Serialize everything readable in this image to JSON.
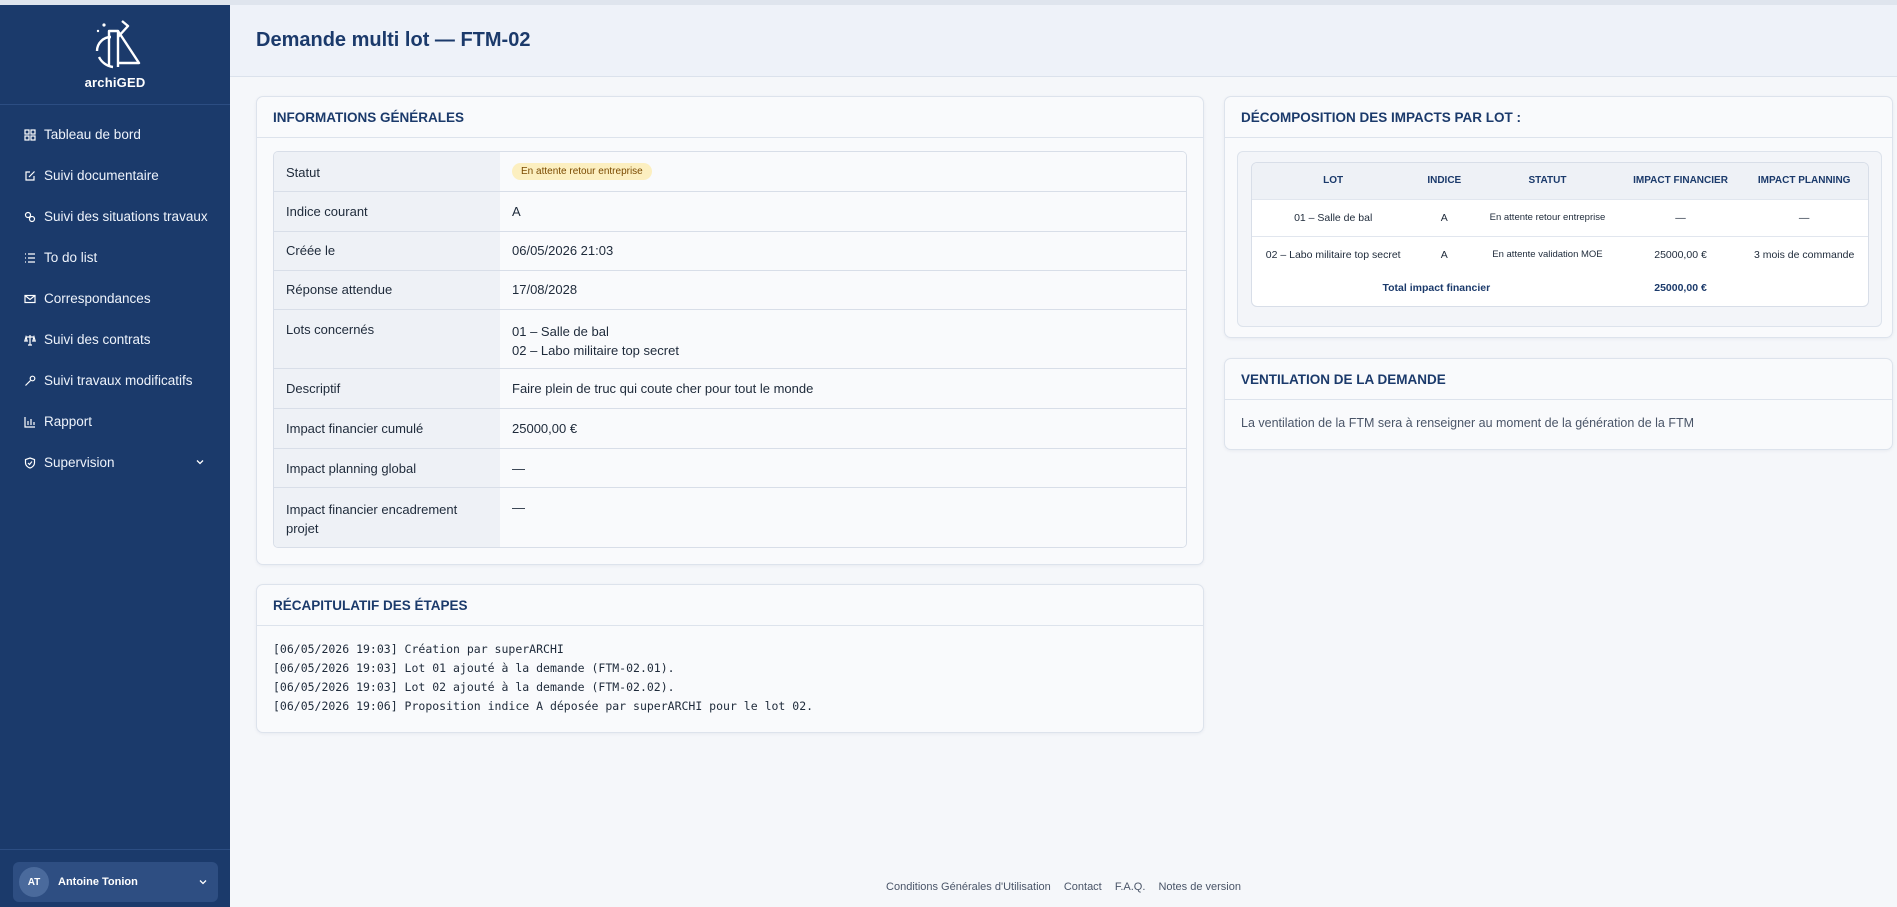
{
  "app": {
    "logo_text": "archiGED"
  },
  "sidebar": {
    "items": [
      {
        "label": "Tableau de bord",
        "icon": "grid-icon"
      },
      {
        "label": "Suivi documentaire",
        "icon": "edit-doc-icon"
      },
      {
        "label": "Suivi des situations travaux",
        "icon": "coins-icon"
      },
      {
        "label": "To do list",
        "icon": "list-icon"
      },
      {
        "label": "Correspondances",
        "icon": "mail-icon"
      },
      {
        "label": "Suivi des contrats",
        "icon": "scale-icon"
      },
      {
        "label": "Suivi travaux modificatifs",
        "icon": "wrench-icon"
      },
      {
        "label": "Rapport",
        "icon": "bar-chart-icon"
      },
      {
        "label": "Supervision",
        "icon": "shield-icon"
      }
    ]
  },
  "user": {
    "initials": "AT",
    "name": "Antoine Tonion"
  },
  "header": {
    "title": "Demande multi lot — FTM-02"
  },
  "general": {
    "title": "INFORMATIONS GÉNÉRALES",
    "rows": {
      "statut": {
        "label": "Statut",
        "value": "En attente retour entreprise"
      },
      "indice": {
        "label": "Indice courant",
        "value": "A"
      },
      "creee": {
        "label": "Créée le",
        "value": "06/05/2026 21:03"
      },
      "reponse": {
        "label": "Réponse attendue",
        "value": "17/08/2028"
      },
      "lots": {
        "label": "Lots concernés",
        "value1": "01 – Salle de bal",
        "value2": "02 – Labo militaire top secret"
      },
      "descriptif": {
        "label": "Descriptif",
        "value": "Faire plein de truc qui coute cher pour tout le monde"
      },
      "impact_fin": {
        "label": "Impact financier cumulé",
        "value": "25000,00 €"
      },
      "impact_plan": {
        "label": "Impact planning global",
        "value": "—"
      },
      "impact_enc": {
        "label": "Impact financier encadrement projet",
        "value": "—"
      }
    }
  },
  "impacts": {
    "title": "DÉCOMPOSITION DES IMPACTS PAR LOT :",
    "headers": [
      "LOT",
      "INDICE",
      "STATUT",
      "IMPACT FINANCIER",
      "IMPACT PLANNING"
    ],
    "rows": [
      [
        "01 – Salle de bal",
        "A",
        "En attente retour entreprise",
        "—",
        "—"
      ],
      [
        "02 – Labo militaire top secret",
        "A",
        "En attente validation MOE",
        "25000,00 €",
        "3 mois de commande"
      ]
    ],
    "total_label": "Total impact financier",
    "total_value": "25000,00 €"
  },
  "ventilation": {
    "title": "VENTILATION DE LA DEMANDE",
    "text": "La ventilation de la FTM sera à renseigner au moment de la génération de la FTM"
  },
  "recap": {
    "title": "RÉCAPITULATIF DES ÉTAPES",
    "lines": [
      "[06/05/2026 19:03] Création par superARCHI",
      "[06/05/2026 19:03] Lot 01 ajouté à la demande (FTM-02.01).",
      "[06/05/2026 19:03] Lot 02 ajouté à la demande (FTM-02.02).",
      "[06/05/2026 19:06] Proposition indice A déposée par superARCHI pour le lot 02."
    ]
  },
  "footer": {
    "links": [
      "Conditions Générales d'Utilisation",
      "Contact",
      "F.A.Q.",
      "Notes de version"
    ]
  }
}
